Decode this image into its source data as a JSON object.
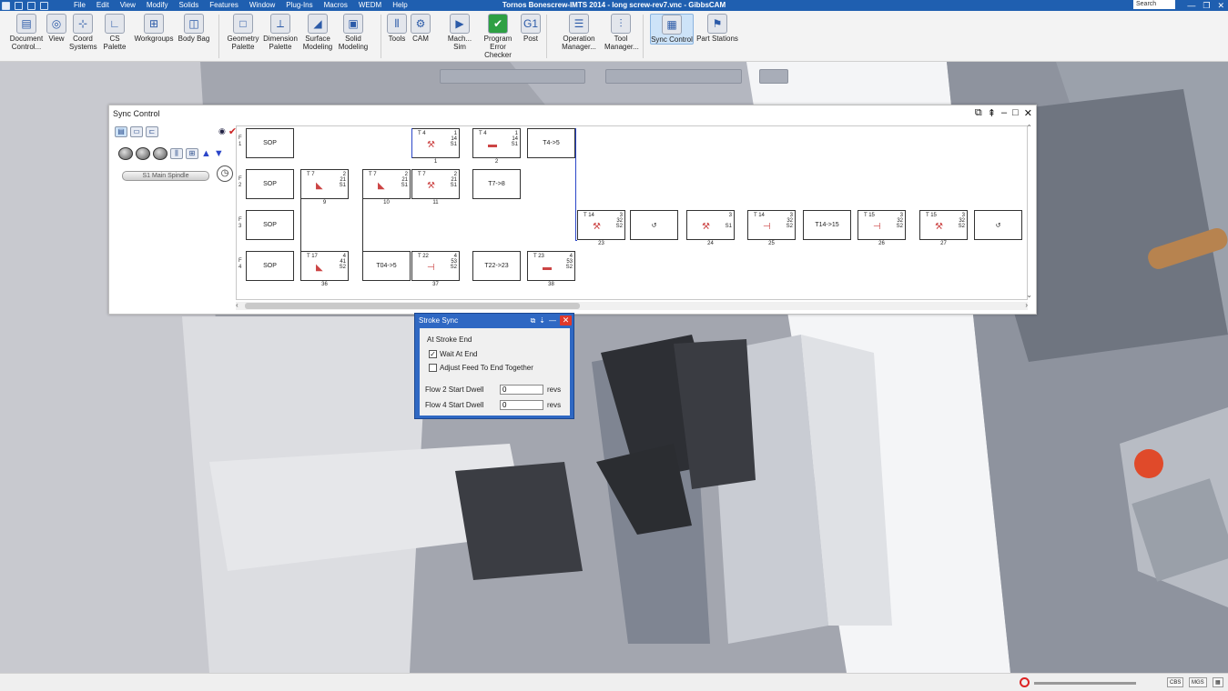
{
  "window": {
    "title": "Tornos Bonescrew-IMTS 2014 - long screw-rev7.vnc - GibbsCAM",
    "search_placeholder": "Search",
    "controls": {
      "minimize": "—",
      "restore": "❐",
      "close": "✕"
    }
  },
  "menu": [
    "File",
    "Edit",
    "View",
    "Modify",
    "Solids",
    "Features",
    "Window",
    "Plug-Ins",
    "Macros",
    "WEDM",
    "Help"
  ],
  "ribbon": [
    {
      "id": "document-control",
      "label": "Document Control...",
      "icon": "document-icon",
      "glyph": "▤"
    },
    {
      "id": "view",
      "label": "View",
      "icon": "globe-icon",
      "glyph": "◎"
    },
    {
      "id": "coord-systems",
      "label": "Coord Systems",
      "icon": "coord-icon",
      "glyph": "⊹"
    },
    {
      "id": "cs-palette",
      "label": "CS Palette",
      "icon": "axes-icon",
      "glyph": "∟"
    },
    {
      "id": "workgroups",
      "label": "Workgroups",
      "icon": "workgroups-icon",
      "glyph": "⊞"
    },
    {
      "id": "body-bag",
      "label": "Body Bag",
      "icon": "bodybag-icon",
      "glyph": "◫"
    },
    {
      "id": "geometry-palette",
      "label": "Geometry Palette",
      "icon": "geometry-icon",
      "glyph": "□"
    },
    {
      "id": "dimension-palette",
      "label": "Dimension Palette",
      "icon": "dimension-icon",
      "glyph": "⟂"
    },
    {
      "id": "surface-modeling",
      "label": "Surface Modeling",
      "icon": "surface-icon",
      "glyph": "◢"
    },
    {
      "id": "solid-modeling",
      "label": "Solid Modeling",
      "icon": "solid-icon",
      "glyph": "▣"
    },
    {
      "id": "tools",
      "label": "Tools",
      "icon": "tools-icon",
      "glyph": "⫴"
    },
    {
      "id": "cam",
      "label": "CAM",
      "icon": "cam-icon",
      "glyph": "⚙"
    },
    {
      "id": "mach-sim",
      "label": "Mach... Sim",
      "icon": "machsim-icon",
      "glyph": "▶"
    },
    {
      "id": "program-error-checker",
      "label": "Program Error Checker",
      "icon": "check-icon",
      "glyph": "✔"
    },
    {
      "id": "post",
      "label": "Post",
      "icon": "post-icon",
      "glyph": "G1"
    },
    {
      "id": "operation-manager",
      "label": "Operation Manager...",
      "icon": "opmanager-icon",
      "glyph": "☰"
    },
    {
      "id": "tool-manager",
      "label": "Tool Manager...",
      "icon": "toolmanager-icon",
      "glyph": "⫶"
    },
    {
      "id": "sync-control",
      "label": "Sync Control",
      "icon": "sync-icon",
      "glyph": "▦"
    },
    {
      "id": "part-stations",
      "label": "Part Stations",
      "icon": "partstations-icon",
      "glyph": "⚑"
    }
  ],
  "sync_control": {
    "title": "Sync Control",
    "spindle_label": "S1 Main Spindle",
    "flows": [
      {
        "label": "F 1",
        "ops": [
          {
            "col": 0,
            "text": "SOP",
            "sop": true
          },
          {
            "col": 3,
            "tool": "T 4",
            "info": "1\n14\nS1",
            "num": "1",
            "glyph": "⚒"
          },
          {
            "col": 4,
            "tool": "T 4",
            "info": "1\n14\nS1",
            "num": "2",
            "glyph": "▬"
          },
          {
            "col": 5,
            "text": "T4->5"
          }
        ]
      },
      {
        "label": "F 2",
        "ops": [
          {
            "col": 0,
            "text": "SOP",
            "sop": true
          },
          {
            "col": 1,
            "tool": "T 7",
            "info": "2\n21\nS1",
            "num": "9",
            "glyph": "◣"
          },
          {
            "col": 2,
            "tool": "T 7",
            "info": "2\n21\nS1",
            "num": "10",
            "glyph": "◣"
          },
          {
            "col": 3,
            "tool": "T 7",
            "info": "2\n21\nS1",
            "num": "11",
            "glyph": "⚒"
          },
          {
            "col": 4,
            "text": "T7->8"
          }
        ]
      },
      {
        "label": "F 3",
        "ops": [
          {
            "col": 0,
            "text": "SOP",
            "sop": true
          },
          {
            "col": 6,
            "tool": "T 14",
            "info": "3\n32\nS2",
            "num": "23",
            "glyph": "⚒"
          },
          {
            "col": 7,
            "text": "↺"
          },
          {
            "col": 8,
            "tool": "",
            "info": "3\n\nS1",
            "num": "24",
            "glyph": "⚒"
          },
          {
            "col": 9,
            "tool": "T 14",
            "info": "3\n32\nS2",
            "num": "25",
            "glyph": "⊣"
          },
          {
            "col": 10,
            "text": "T14->15"
          },
          {
            "col": 11,
            "tool": "T 15",
            "info": "3\n32\nS2",
            "num": "26",
            "glyph": "⊣"
          },
          {
            "col": 12,
            "tool": "T 15",
            "info": "3\n32\nS2",
            "num": "27",
            "glyph": "⚒"
          },
          {
            "col": 13,
            "text": "↺"
          }
        ]
      },
      {
        "label": "F 4",
        "ops": [
          {
            "col": 0,
            "text": "SOP",
            "sop": true
          },
          {
            "col": 1,
            "tool": "T 17",
            "info": "4\n41\nS2",
            "num": "36",
            "glyph": "◣"
          },
          {
            "col": 2,
            "text": "T04->5"
          },
          {
            "col": 3,
            "tool": "T 22",
            "info": "4\n53\nS2",
            "num": "37",
            "glyph": "⊣"
          },
          {
            "col": 4,
            "text": "T22->23"
          },
          {
            "col": 5,
            "tool": "T 23",
            "info": "4\n53\nS2",
            "num": "38",
            "glyph": "▬"
          }
        ]
      }
    ]
  },
  "stroke_sync": {
    "title": "Stroke Sync",
    "group_label": "At Stroke End",
    "wait_at_end": {
      "label": "Wait At End",
      "checked": true
    },
    "adjust_feed": {
      "label": "Adjust Feed To End Together",
      "checked": false
    },
    "flow2_dwell": {
      "label": "Flow 2 Start Dwell",
      "value": "0",
      "unit": "revs"
    },
    "flow4_dwell": {
      "label": "Flow 4 Start Dwell",
      "value": "0",
      "unit": "revs"
    }
  },
  "status": {
    "cbs": "CBS",
    "mgs": "MGS"
  },
  "colors": {
    "titlebar": "#1f5fb0",
    "accent": "#2b46c9",
    "close_red": "#e0392b"
  }
}
